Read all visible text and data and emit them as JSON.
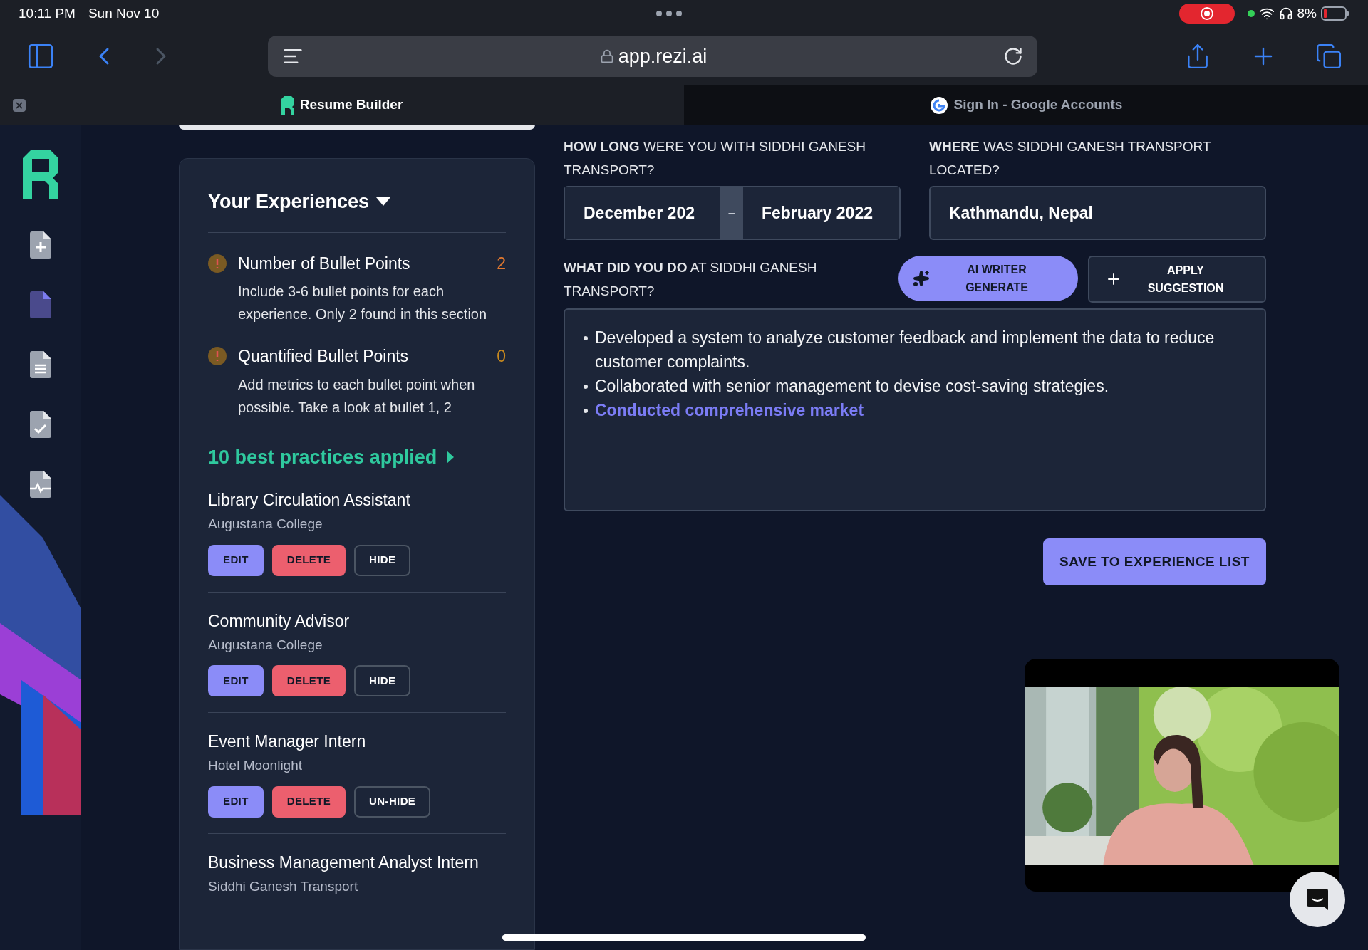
{
  "status_bar": {
    "time": "10:11 PM",
    "date": "Sun Nov 10",
    "battery": "8%",
    "recording": true
  },
  "browser": {
    "url": "app.rezi.ai",
    "back_enabled": true,
    "forward_enabled": false,
    "tabs": [
      {
        "title": "Resume Builder",
        "selected": true
      },
      {
        "title": "Sign In - Google Accounts",
        "selected": false
      }
    ]
  },
  "sidebar": {
    "items": [
      {
        "selected": false
      },
      {
        "selected": true
      },
      {
        "selected": false
      },
      {
        "selected": false
      },
      {
        "selected": false
      }
    ]
  },
  "experiences": {
    "title": "Your Experiences",
    "checks": [
      {
        "title": "Number of Bullet Points",
        "count": "2",
        "color": "#e0782f",
        "description": "Include 3-6 bullet points for each experience. Only 2 found in this section"
      },
      {
        "title": "Quantified Bullet Points",
        "count": "0",
        "color": "#c98a1e",
        "description": "Add metrics to each bullet point when possible. Take a look at bullet 1, 2"
      }
    ],
    "best_practices": "10 best practices applied",
    "items": [
      {
        "title": "Library Circulation Assistant",
        "company": "Augustana College",
        "buttons": [
          {
            "kind": "edit",
            "label": "EDIT"
          },
          {
            "kind": "delete",
            "label": "DELETE"
          },
          {
            "kind": "toggle",
            "label": "HIDE"
          }
        ]
      },
      {
        "title": "Community Advisor",
        "company": "Augustana College",
        "buttons": [
          {
            "kind": "edit",
            "label": "EDIT"
          },
          {
            "kind": "delete",
            "label": "DELETE"
          },
          {
            "kind": "toggle",
            "label": "HIDE"
          }
        ]
      },
      {
        "title": "Event Manager Intern",
        "company": "Hotel Moonlight",
        "buttons": [
          {
            "kind": "edit",
            "label": "EDIT"
          },
          {
            "kind": "delete",
            "label": "DELETE"
          },
          {
            "kind": "toggle",
            "label": "UN-HIDE"
          }
        ]
      },
      {
        "title": "Business Management Analyst Intern",
        "company": "Siddhi Ganesh Transport"
      }
    ]
  },
  "form": {
    "duration": {
      "label": "**HOW LONG** WERE YOU WITH SIDDHI GANESH TRANSPORT?",
      "start": "December 202",
      "separator": "–",
      "end": "February 2022"
    },
    "location": {
      "label": "**WHERE** WAS SIDDHI GANESH TRANSPORT LOCATED?",
      "value": "Kathmandu, Nepal"
    },
    "duties": {
      "label": "**WHAT DID YOU DO** AT SIDDHI GANESH TRANSPORT?",
      "ai_button": [
        "AI WRITER",
        "GENERATE"
      ],
      "apply_button": [
        "APPLY",
        "SUGGESTION"
      ],
      "bullets": [
        {
          "kind": "text",
          "text": "Developed a system to analyze customer feedback and implement the data to reduce customer complaints."
        },
        {
          "kind": "text",
          "text": "Collaborated with senior management to devise cost-saving strategies."
        },
        {
          "kind": "suggestion",
          "text": "Conducted comprehensive market"
        }
      ]
    },
    "save_button": "SAVE TO EXPERIENCE LIST"
  }
}
